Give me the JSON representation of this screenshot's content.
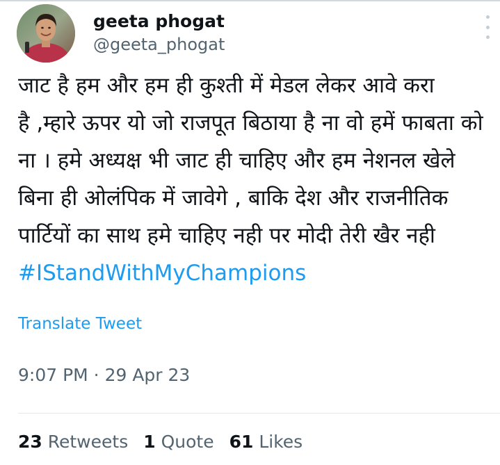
{
  "tweet": {
    "author": {
      "display_name": "geeta phogat",
      "handle": "@geeta_phogat"
    },
    "text_lines": [
      "जाट है हम और हम ही कुश्ती में मेडल लेकर आवे करा",
      "है ,म्हारे ऊपर यो जो राजपूत बिठाया है ना वो हमें फाबता को",
      "ना । हमे अध्यक्ष भी जाट ही चाहिए और हम नेशनल खेले",
      "बिना ही ओलंपिक में जावेगे , बाकि देश और राजनीतिक",
      "पार्टियों का साथ हमे चाहिए नही पर मोदी तेरी खैर नही"
    ],
    "hashtag": "#IStandWithMyChampions",
    "translate_label": "Translate Tweet",
    "timestamp": "9:07 PM · 29 Apr 23",
    "stats": {
      "retweets_count": "23",
      "retweets_label": "Retweets",
      "quotes_count": "1",
      "quotes_label": "Quote",
      "likes_count": "61",
      "likes_label": "Likes"
    }
  },
  "colors": {
    "link": "#1d9bf0",
    "secondary_text": "#536471",
    "primary_text": "#0f1419"
  },
  "icons": {
    "more": "more-vertical-icon",
    "avatar": "profile-photo"
  }
}
